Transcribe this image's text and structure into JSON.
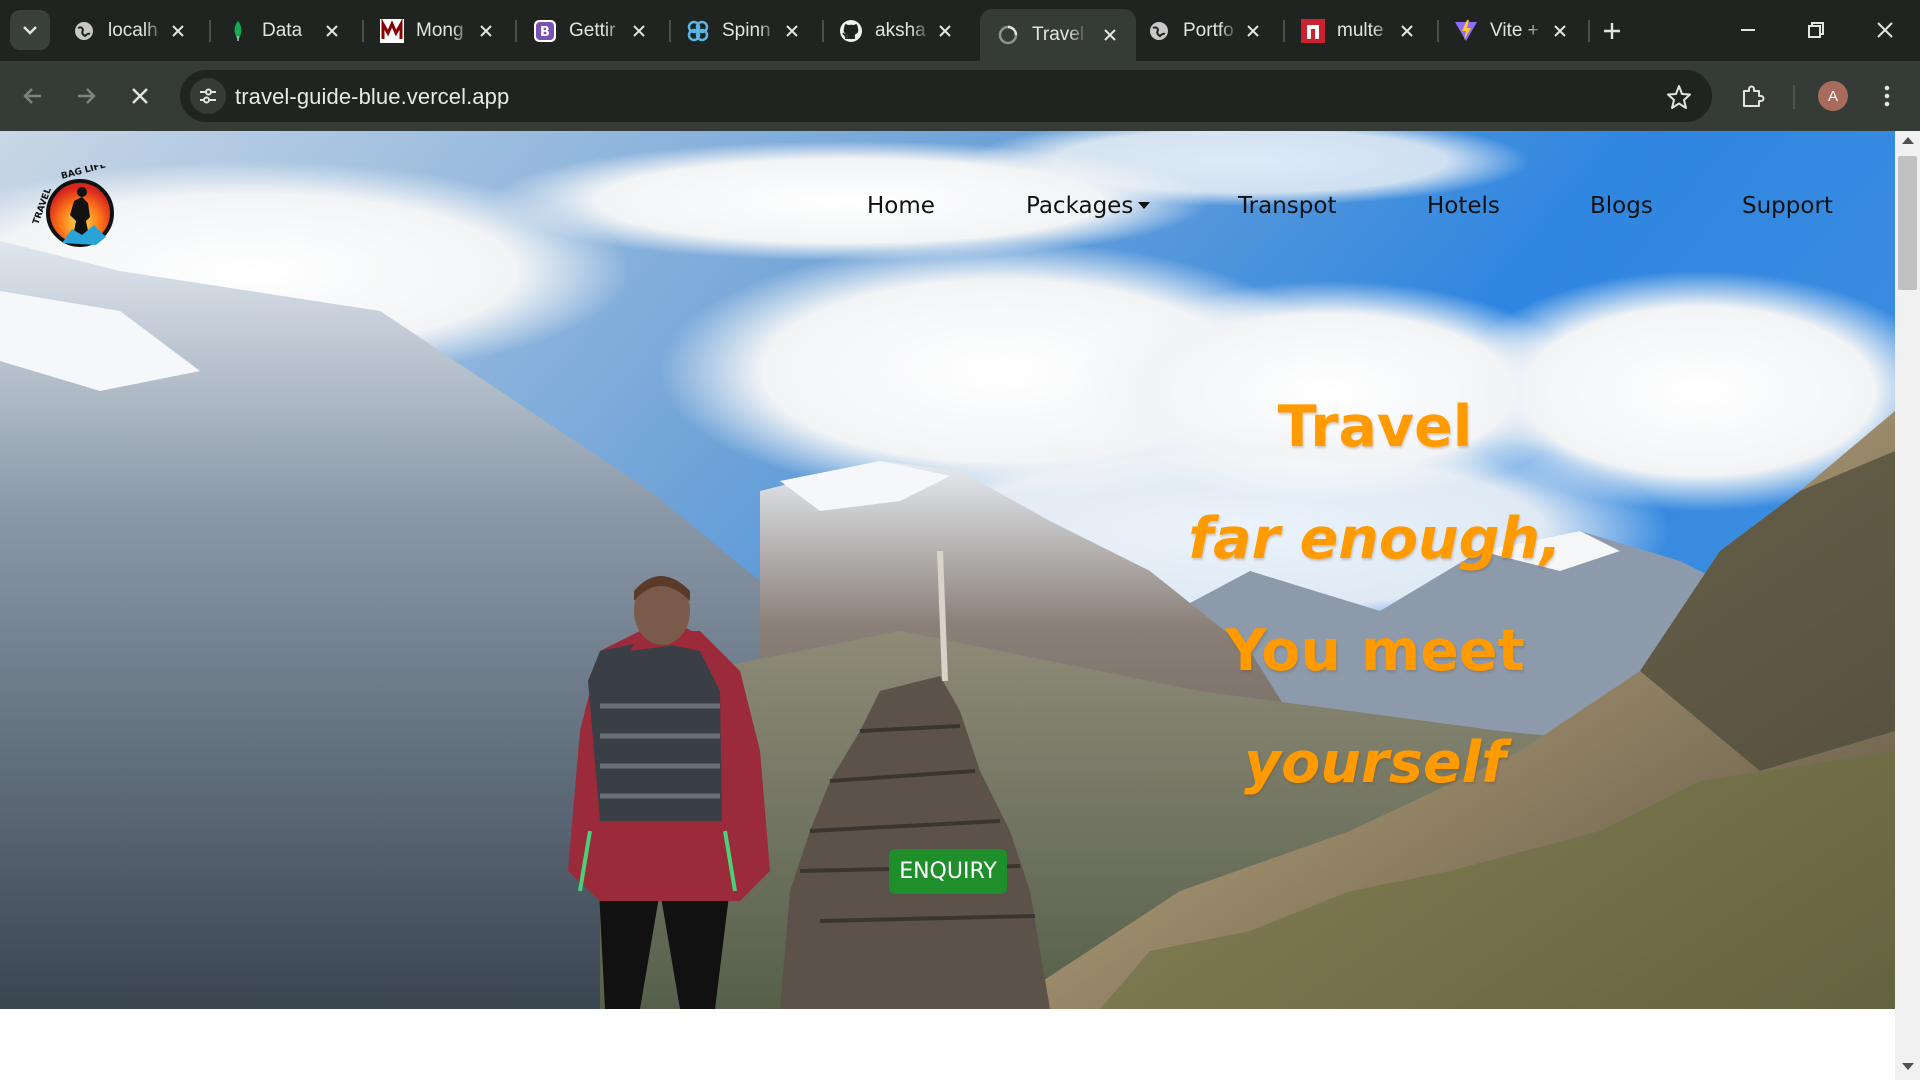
{
  "browser": {
    "tabs": [
      {
        "title": "localh",
        "icon": "globe-icon"
      },
      {
        "title": "Data",
        "icon": "mongodb-leaf-icon"
      },
      {
        "title": "Mong",
        "icon": "mongoose-icon"
      },
      {
        "title": "Gettir",
        "icon": "bootstrap-icon"
      },
      {
        "title": "Spinn",
        "icon": "spinner-icon"
      },
      {
        "title": "aksha",
        "icon": "github-icon"
      },
      {
        "title": "Travel",
        "icon": "loading-icon",
        "active": true
      },
      {
        "title": "Portfo",
        "icon": "globe-icon"
      },
      {
        "title": "multe",
        "icon": "multer-icon"
      },
      {
        "title": "Vite +",
        "icon": "vite-icon"
      }
    ],
    "url": "travel-guide-blue.vercel.app",
    "profile_initial": "A"
  },
  "site": {
    "nav": {
      "home": "Home",
      "packages": "Packages",
      "transport": "Transpot",
      "hotels": "Hotels",
      "blogs": "Blogs",
      "support": "Support"
    },
    "logo_text": "TRAVEL BAG LIFE",
    "hero": {
      "line1": "Travel",
      "line2": "far enough,",
      "line3": "You meet",
      "line4": "yourself"
    },
    "enquiry_label": "ENQUIRY"
  },
  "colors": {
    "chrome_dark": "#1f2420",
    "chrome_toolbar": "#353b36",
    "hero_text": "#ff9a00",
    "enquiry_button": "#1e8f2b"
  }
}
